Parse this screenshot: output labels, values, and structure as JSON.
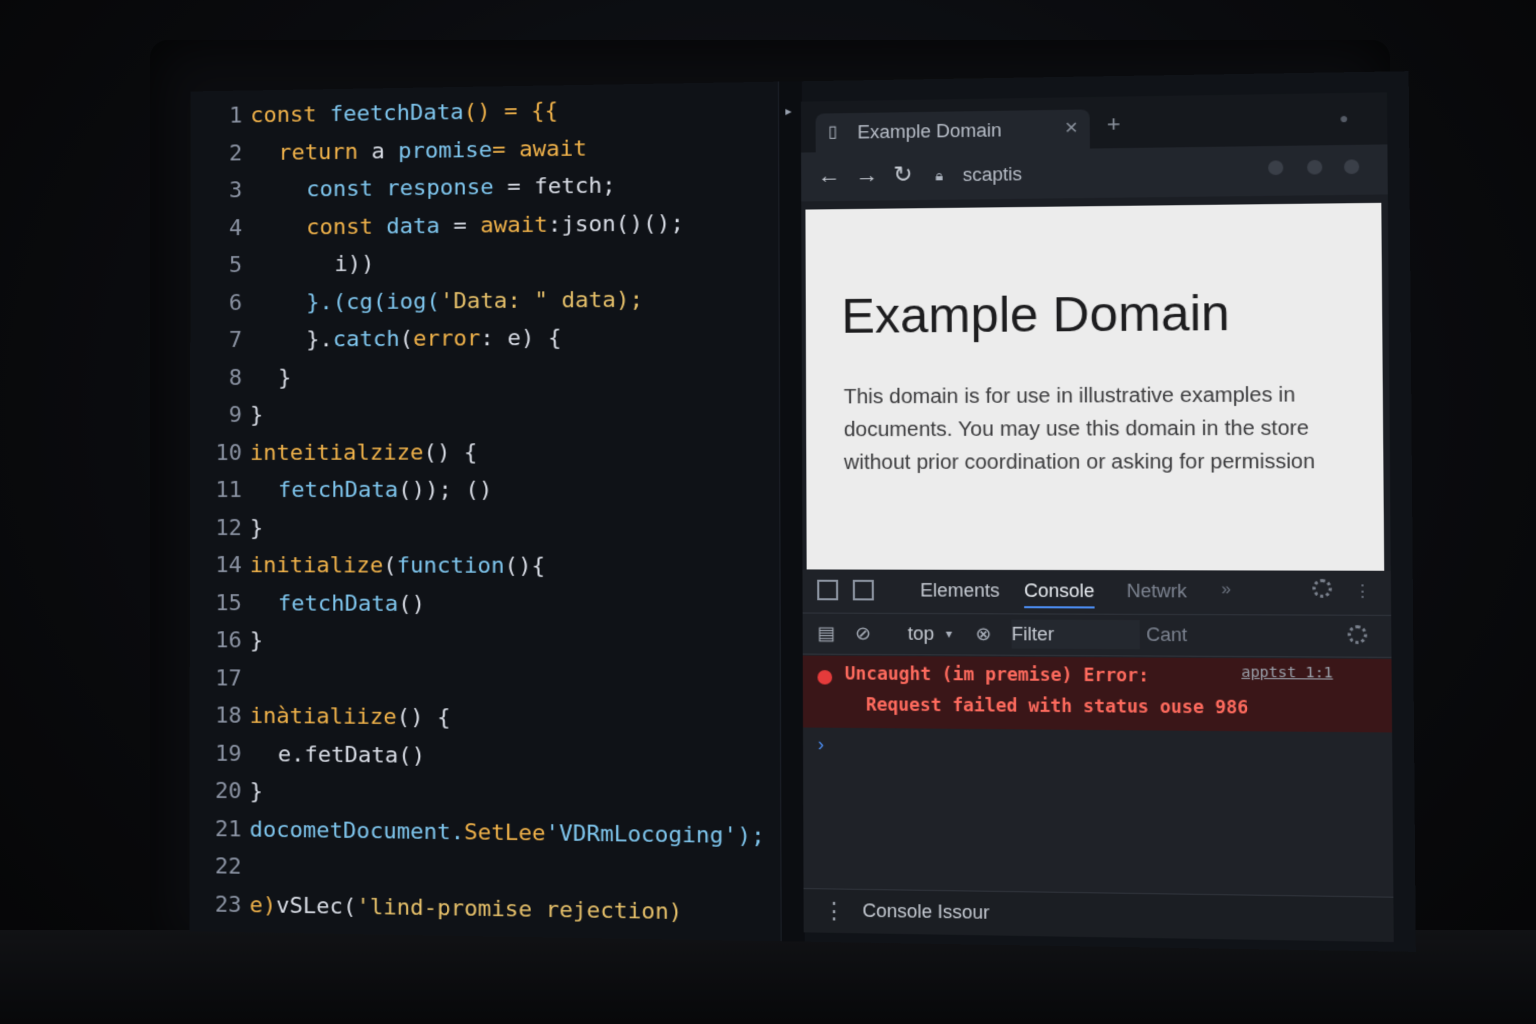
{
  "editor": {
    "lines": [
      {
        "no": "1",
        "segs": [
          {
            "t": "const ",
            "c": "kw"
          },
          {
            "t": "feetchData",
            "c": "fn"
          },
          {
            "t": "() = {{",
            "c": "kw"
          }
        ],
        "indent": 0
      },
      {
        "no": "2",
        "segs": [
          {
            "t": "return ",
            "c": "kw"
          },
          {
            "t": "a ",
            "c": "txt"
          },
          {
            "t": "promise",
            "c": "fn"
          },
          {
            "t": "= await",
            "c": "kw"
          }
        ],
        "indent": 1
      },
      {
        "no": "3",
        "segs": [
          {
            "t": "const ",
            "c": "fn"
          },
          {
            "t": "response",
            "c": "fn"
          },
          {
            "t": " = ",
            "c": "txt"
          },
          {
            "t": "fetch;",
            "c": "txt"
          }
        ],
        "indent": 2
      },
      {
        "no": "4",
        "segs": [
          {
            "t": "const ",
            "c": "kw"
          },
          {
            "t": "data",
            "c": "fn"
          },
          {
            "t": " = ",
            "c": "txt"
          },
          {
            "t": "await",
            "c": "kw"
          },
          {
            "t": ":json()();",
            "c": "txt"
          }
        ],
        "indent": 2
      },
      {
        "no": "5",
        "segs": [
          {
            "t": "i))",
            "c": "txt"
          }
        ],
        "indent": 3
      },
      {
        "no": "6",
        "segs": [
          {
            "t": "}.(cg(iog(",
            "c": "fn"
          },
          {
            "t": "'Data: \" data);",
            "c": "str"
          }
        ],
        "indent": 2
      },
      {
        "no": "7",
        "segs": [
          {
            "t": "}.",
            "c": "txt"
          },
          {
            "t": "catch",
            "c": "fn"
          },
          {
            "t": "(",
            "c": "txt"
          },
          {
            "t": "error",
            "c": "kw"
          },
          {
            "t": ": e) {",
            "c": "txt"
          }
        ],
        "indent": 2
      },
      {
        "no": "8",
        "segs": [
          {
            "t": "}",
            "c": "txt"
          }
        ],
        "indent": 1
      },
      {
        "no": "9",
        "segs": [
          {
            "t": "}",
            "c": "txt"
          }
        ],
        "indent": 0
      },
      {
        "no": "10",
        "segs": [
          {
            "t": "inteitialzize",
            "c": "kw"
          },
          {
            "t": "() {",
            "c": "txt"
          }
        ],
        "indent": 0
      },
      {
        "no": "11",
        "segs": [
          {
            "t": "fetchData",
            "c": "fn"
          },
          {
            "t": "()); ()",
            "c": "txt"
          }
        ],
        "indent": 1
      },
      {
        "no": "12",
        "segs": [
          {
            "t": "}",
            "c": "txt"
          }
        ],
        "indent": 0
      },
      {
        "no": "14",
        "segs": [
          {
            "t": "initialize",
            "c": "kw"
          },
          {
            "t": "(",
            "c": "txt"
          },
          {
            "t": "function",
            "c": "fn"
          },
          {
            "t": "(){",
            "c": "txt"
          }
        ],
        "indent": 0
      },
      {
        "no": "15",
        "segs": [
          {
            "t": "fetchData",
            "c": "fn"
          },
          {
            "t": "()",
            "c": "txt"
          }
        ],
        "indent": 1
      },
      {
        "no": "16",
        "segs": [
          {
            "t": "}",
            "c": "txt"
          }
        ],
        "indent": 0
      },
      {
        "no": "17",
        "segs": [],
        "indent": 0
      },
      {
        "no": "18",
        "segs": [
          {
            "t": "inàtialiize",
            "c": "kw"
          },
          {
            "t": "() {",
            "c": "txt"
          }
        ],
        "indent": 0
      },
      {
        "no": "19",
        "segs": [
          {
            "t": "e.fetData()",
            "c": "txt"
          }
        ],
        "indent": 1
      },
      {
        "no": "20",
        "segs": [
          {
            "t": "}",
            "c": "txt"
          }
        ],
        "indent": 0
      },
      {
        "no": "21",
        "segs": [
          {
            "t": "docometDocument.",
            "c": "fn"
          },
          {
            "t": "SetLee",
            "c": "kw"
          },
          {
            "t": "'VDRmLocoging');",
            "c": "fn"
          }
        ],
        "indent": 0
      },
      {
        "no": "22",
        "segs": [],
        "indent": 0
      },
      {
        "no": "23",
        "segs": [
          {
            "t": "e)",
            "c": "kw"
          },
          {
            "t": "vSLec(",
            "c": "txt"
          },
          {
            "t": "'lind-promise rejection)",
            "c": "str"
          }
        ],
        "indent": 0
      }
    ]
  },
  "browser": {
    "tab_title": "Example Domain",
    "tab_icon": "page-icon",
    "url": "scaptis",
    "page": {
      "title": "Example Domain",
      "paragraph": "This domain is for use in illustrative examples in documents. You may use this domain in the store without prior coordination or asking for permission"
    }
  },
  "devtools": {
    "tabs": [
      "Elements",
      "Console",
      "Netwrk"
    ],
    "active_tab": "Console",
    "context": "top",
    "filter_placeholder": "Filter",
    "levels": "Cant",
    "error_line1": "Uncaught (im premise) Error:",
    "error_line2": "Request failed with status ouse 986",
    "error_source": "apptst 1:1",
    "prompt": "›",
    "drawer_title": "Console Issour"
  },
  "colors": {
    "keyword": "#f0b24a",
    "function": "#7fc6ee",
    "string": "#e6c06a",
    "error": "#ff6b5e",
    "accent": "#4b8cf0"
  }
}
